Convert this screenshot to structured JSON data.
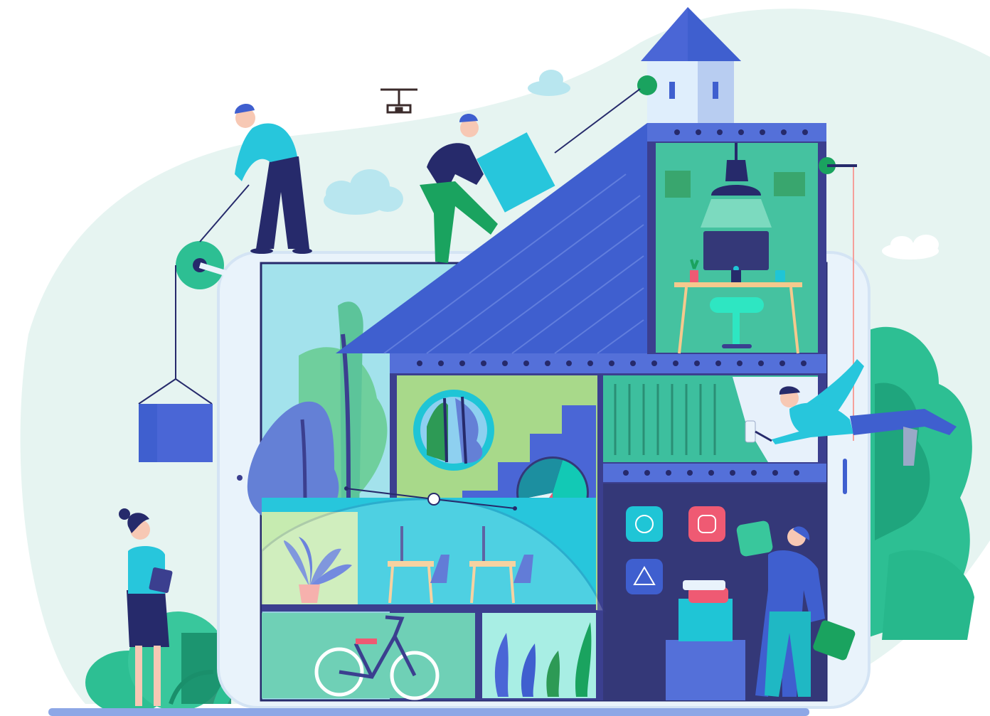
{
  "illustration": {
    "palette": {
      "background_blob": "#e6f4f1",
      "roof": "#3f5fcf",
      "roof_light": "#5c7de0",
      "tower_wall": "#dfeefc",
      "tablet_frame": "#e9f3fb",
      "tablet_screen": "#a3e2ec",
      "wall_dark": "#3b3f8f",
      "navy": "#262a6b",
      "studio_green": "#3dbf9e",
      "teal": "#1fc5d6",
      "green": "#1aa35f",
      "pink": "#ef5a73",
      "wood": "#f5c98d",
      "floor_bar": "#8da7e6"
    },
    "icons": [
      "drone-icon",
      "cloud-icon",
      "pulley-icon",
      "desk-lamp-icon",
      "computer-monitor-icon",
      "bicycle-icon",
      "plant-icon",
      "pie-chart-icon",
      "circle-app-icon",
      "square-app-icon",
      "triangle-app-icon",
      "paint-roller-icon",
      "clipboard-icon"
    ],
    "pie_chart": {
      "segments": [
        {
          "label": "",
          "share": 0.45,
          "color": "#12c9b5"
        },
        {
          "label": "",
          "share": 0.1,
          "color": "#ef5a73"
        },
        {
          "label": "",
          "share": 0.12,
          "color": "#e4f4f7"
        },
        {
          "label": "",
          "share": 0.33,
          "color": "#1c8fa0"
        }
      ]
    }
  }
}
